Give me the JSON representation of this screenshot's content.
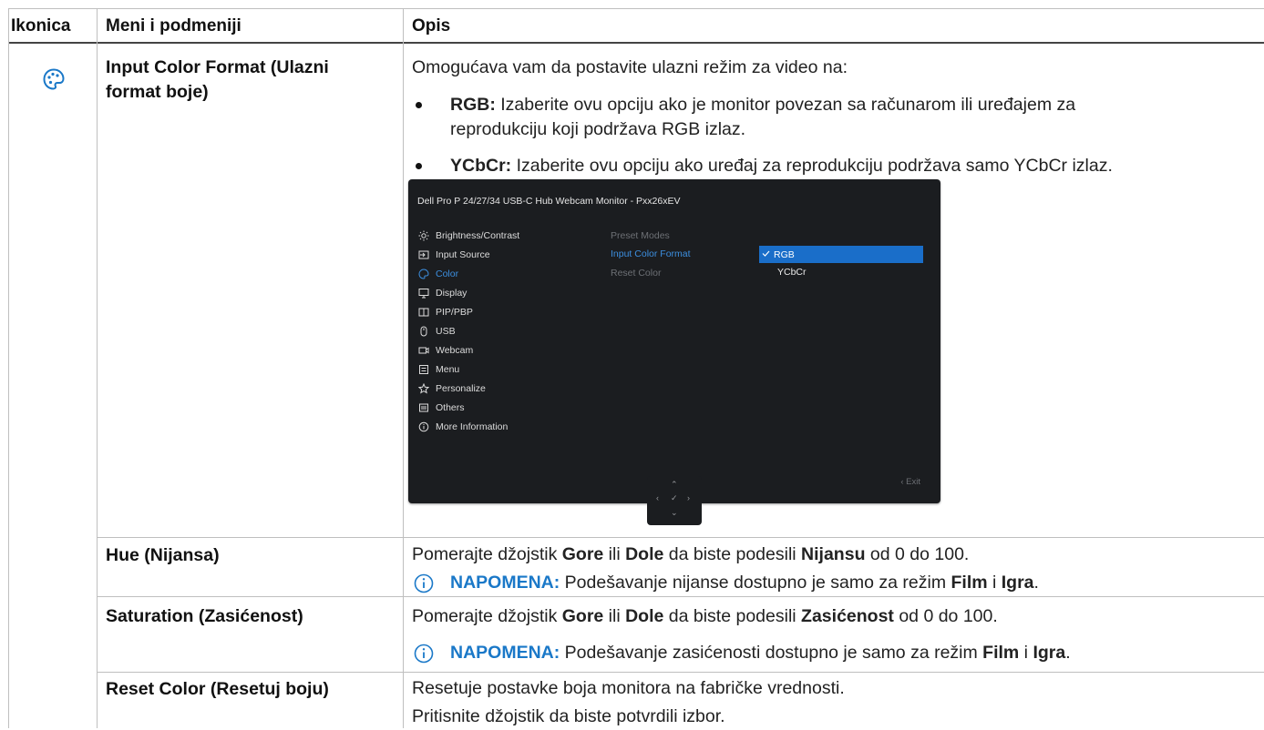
{
  "table": {
    "headers": [
      "Ikonica",
      "Meni i podmeniji",
      "Opis"
    ]
  },
  "rows": {
    "input_color": {
      "menu": "Input Color Format (Ulazni format boje)",
      "menu_line1": "Input Color Format (Ulazni",
      "menu_line2": "format boje)",
      "intro": "Omogućava vam da postavite ulazni režim za video na:",
      "rgb_label": "RGB:",
      "rgb_text_line1": "Izaberite ovu opciju ako je monitor povezan sa računarom ili uređajem za",
      "rgb_text_line2": "reprodukciju koji podržava RGB izlaz.",
      "ycbcr_label": "YCbCr:",
      "ycbcr_text": "Izaberite ovu opciju ako uređaj za reprodukciju podržava samo YCbCr izlaz."
    },
    "hue": {
      "menu": "Hue (Nijansa)",
      "desc_pre": "Pomerajte džojstik ",
      "up": "Gore",
      "or": " ili ",
      "down": "Dole",
      "desc_mid": " da biste podesili ",
      "target": "Nijansu",
      "desc_post": " od 0 do 100.",
      "note_label": "NAPOMENA:",
      "note_text": " Podešavanje nijanse dostupno je samo za režim ",
      "note_mode1": "Film",
      "note_and": " i ",
      "note_mode2": "Igra",
      "note_end": "."
    },
    "saturation": {
      "menu": "Saturation (Zasićenost)",
      "desc_pre": "Pomerajte džojstik ",
      "up": "Gore",
      "or": " ili ",
      "down": "Dole",
      "desc_mid": " da biste podesili ",
      "target": "Zasićenost",
      "desc_post": " od 0 do 100.",
      "note_label": "NAPOMENA:",
      "note_text": " Podešavanje zasićenosti dostupno je samo za režim ",
      "note_mode1": "Film",
      "note_and": " i ",
      "note_mode2": "Igra",
      "note_end": "."
    },
    "reset": {
      "menu": "Reset Color (Resetuj boju)",
      "line1": "Resetuje postavke boja monitora na fabričke vrednosti.",
      "line2": "Pritisnite džojstik da biste potvrdili izbor."
    }
  },
  "osd": {
    "title": "Dell Pro P 24/27/34 USB-C Hub Webcam Monitor - Pxx26xEV",
    "menu": [
      {
        "label": "Brightness/Contrast",
        "icon": "sun-icon"
      },
      {
        "label": "Input Source",
        "icon": "input-icon"
      },
      {
        "label": "Color",
        "icon": "palette-icon"
      },
      {
        "label": "Display",
        "icon": "monitor-icon"
      },
      {
        "label": "PIP/PBP",
        "icon": "pip-icon"
      },
      {
        "label": "USB",
        "icon": "mouse-icon"
      },
      {
        "label": "Webcam",
        "icon": "webcam-icon"
      },
      {
        "label": "Menu",
        "icon": "menu-icon"
      },
      {
        "label": "Personalize",
        "icon": "star-icon"
      },
      {
        "label": "Others",
        "icon": "others-icon"
      },
      {
        "label": "More Information",
        "icon": "info-icon"
      }
    ],
    "submenu": [
      "Preset Modes",
      "Input Color Format",
      "Reset Color"
    ],
    "options": [
      "RGB",
      "YCbCr"
    ],
    "exit": "Exit"
  },
  "colors": {
    "accent": "#1a78c8",
    "osd_bg": "#1b1d20",
    "osd_highlight": "#1a6ec9"
  }
}
